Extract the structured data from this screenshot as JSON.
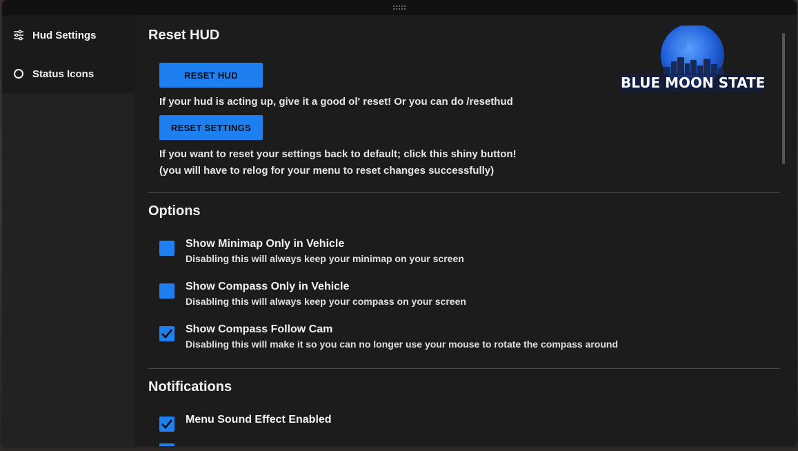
{
  "sidebar": {
    "items": [
      {
        "label": "Hud Settings",
        "icon": "sliders-icon"
      },
      {
        "label": "Status Icons",
        "icon": "circle-icon"
      }
    ]
  },
  "logo": {
    "text": "BLUE MOON STATE"
  },
  "reset": {
    "title": "Reset HUD",
    "reset_hud_button": "RESET HUD",
    "reset_hud_desc": "If your hud is acting up, give it a good ol' reset! Or you can do /resethud",
    "reset_settings_button": "RESET SETTINGS",
    "reset_settings_desc_1": "If you want to reset your settings back to default; click this shiny button!",
    "reset_settings_desc_2": "(you will have to relog for your menu to reset changes successfully)"
  },
  "options": {
    "title": "Options",
    "items": [
      {
        "label": "Show Minimap Only in Vehicle",
        "sub": "Disabling this will always keep your minimap on your screen",
        "checked": false
      },
      {
        "label": "Show Compass Only in Vehicle",
        "sub": "Disabling this will always keep your compass on your screen",
        "checked": false
      },
      {
        "label": "Show Compass Follow Cam",
        "sub": "Disabling this will make it so you can no longer use your mouse to rotate the compass around",
        "checked": true
      }
    ]
  },
  "notifications": {
    "title": "Notifications",
    "items": [
      {
        "label": "Menu Sound Effect Enabled",
        "checked": true
      }
    ]
  },
  "colors": {
    "accent": "#1e7ff0",
    "background": "#1c1c1c",
    "sidebar": "#1a1a1a"
  }
}
